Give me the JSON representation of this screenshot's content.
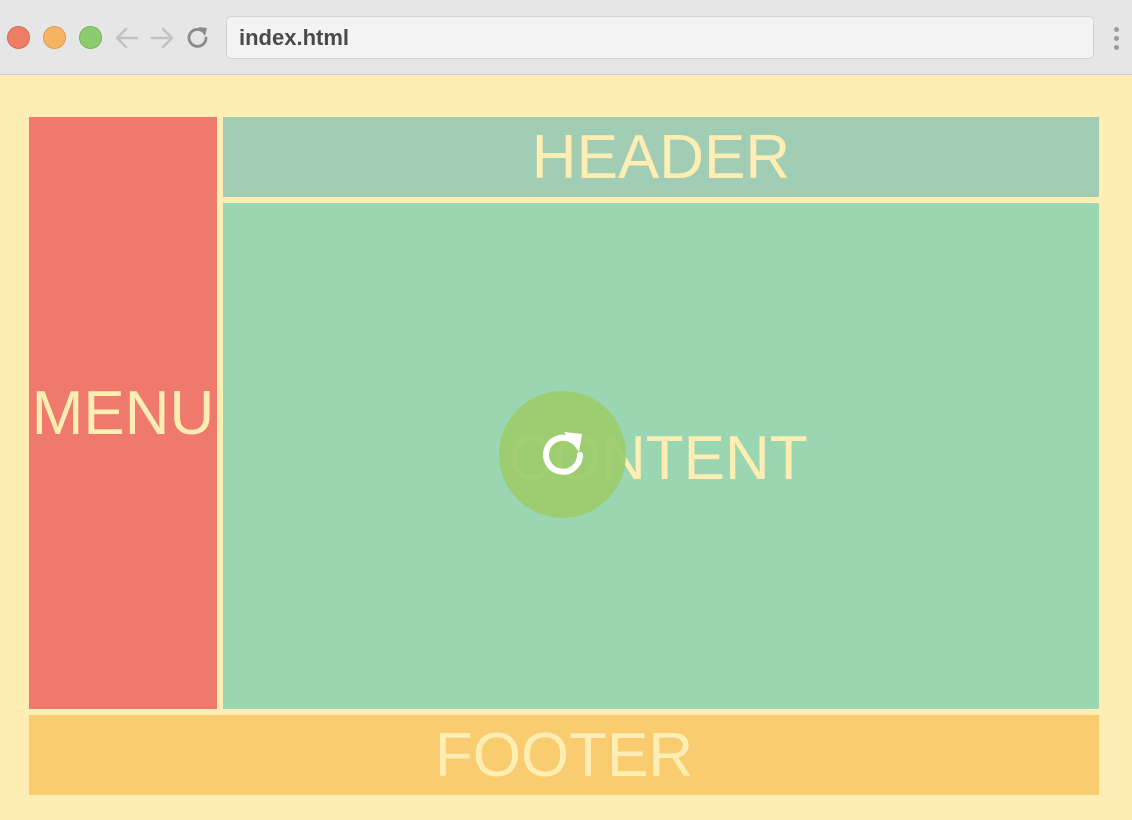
{
  "browser": {
    "url": "index.html",
    "traffic_lights": {
      "close_color": "#ed7f67",
      "minimize_color": "#f4b462",
      "maximize_color": "#8ccb6e"
    },
    "icons": {
      "back": "arrow-left-icon",
      "forward": "arrow-right-icon",
      "reload": "reload-icon",
      "menu": "vertical-ellipsis-icon"
    }
  },
  "layout": {
    "menu_label": "MENU",
    "header_label": "HEADER",
    "content_label": "CONTENT",
    "footer_label": "FOOTER",
    "colors": {
      "page_background": "#feeeb3",
      "menu": "#f0796e",
      "header": "#a0cdb4",
      "content": "#9bd6b3",
      "footer": "#f9cc6f",
      "label_text": "#feeeb3"
    }
  },
  "overlay": {
    "icon": "refresh-icon",
    "color": "#9ccc6a"
  }
}
